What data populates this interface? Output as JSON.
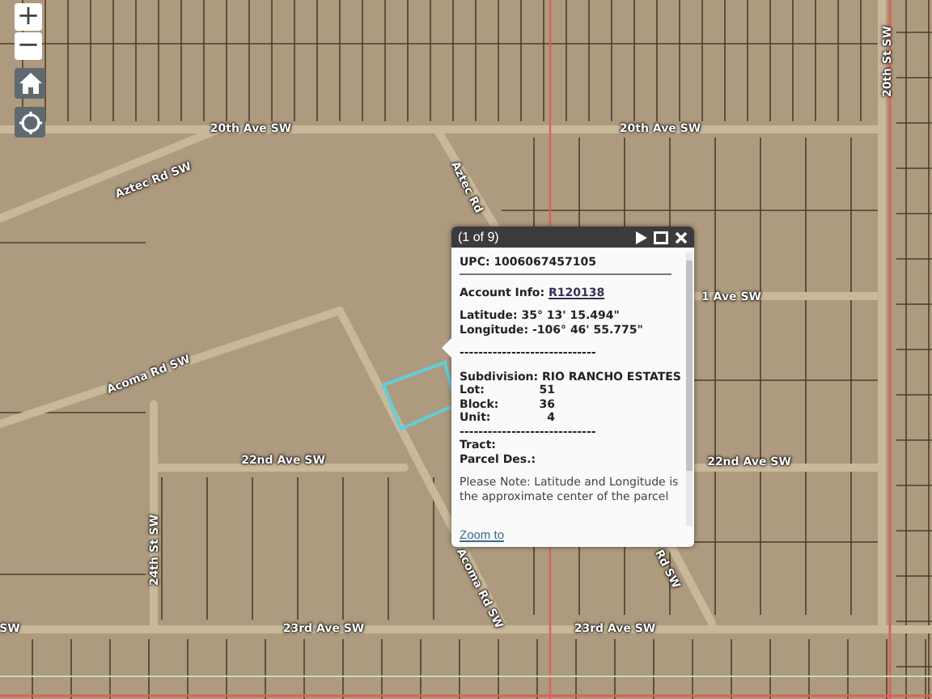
{
  "map": {
    "labels": [
      {
        "text": "20th Ave SW",
        "kind": "horizontal"
      },
      {
        "text": "20th Ave SW",
        "kind": "horizontal"
      },
      {
        "text": "Aztec Rd SW",
        "kind": "rising"
      },
      {
        "text": "Aztec Rd",
        "kind": "falling"
      },
      {
        "text": "Acoma Rd SW",
        "kind": "rising"
      },
      {
        "text": "1 Ave SW",
        "kind": "horizontal"
      },
      {
        "text": "22nd Ave SW",
        "kind": "horizontal"
      },
      {
        "text": "22nd Ave SW",
        "kind": "horizontal"
      },
      {
        "text": "24th St SW",
        "kind": "vertical"
      },
      {
        "text": "Acoma Rd SW",
        "kind": "falling"
      },
      {
        "text": "Rd SW",
        "kind": "falling"
      },
      {
        "text": "SW",
        "kind": "horizontal"
      },
      {
        "text": "23rd Ave SW",
        "kind": "horizontal"
      },
      {
        "text": "23rd Ave SW",
        "kind": "horizontal"
      },
      {
        "text": "20th St SW",
        "kind": "vertical"
      }
    ]
  },
  "controls": {
    "zoom_in": "+",
    "zoom_out": "−"
  },
  "popup": {
    "title": "(1 of 9)",
    "upc": "UPC: 1006067457105",
    "account_label": "Account Info:",
    "account_link": "R120138",
    "latitude": "Latitude: 35° 13' 15.494\"",
    "longitude": "Longitude: -106° 46' 55.775\"",
    "separator": "-----------------------------",
    "subdivision": "Subdivision: RIO RANCHO ESTATES",
    "fields": [
      {
        "label": "Lot:",
        "value": "51"
      },
      {
        "label": "Block:",
        "value": "36"
      },
      {
        "label": "Unit:",
        "value": "4"
      }
    ],
    "separator_2": "-----------------------------",
    "tract": "Tract:",
    "parcel": "Parcel Des.:",
    "note": "Please Note: Latitude and Longitude is the approximate center of the parcel",
    "zoom_link": "Zoom to"
  }
}
